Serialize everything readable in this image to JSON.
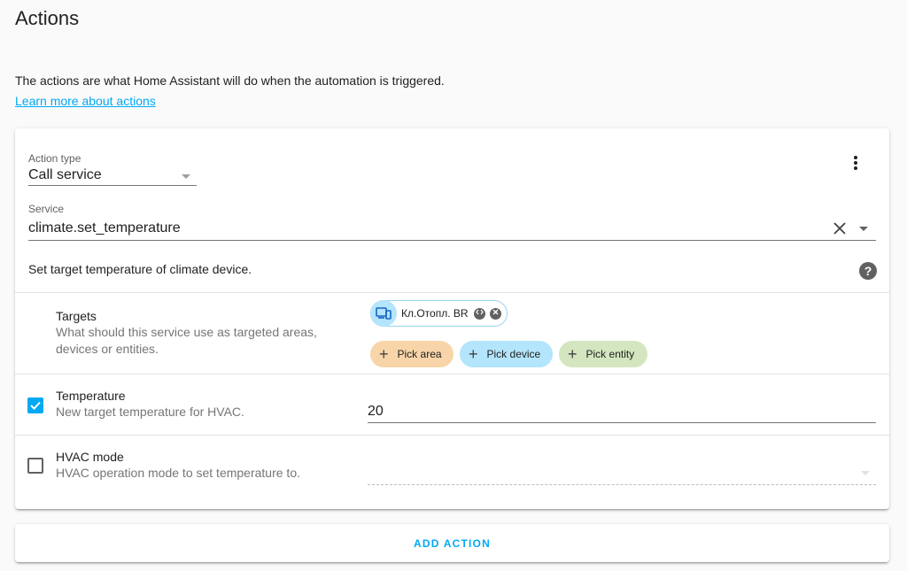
{
  "page": {
    "title": "Actions",
    "intro": "The actions are what Home Assistant will do when the automation is triggered.",
    "learn_more": "Learn more about actions"
  },
  "action": {
    "type_label": "Action type",
    "type_value": "Call service",
    "service_label": "Service",
    "service_value": "climate.set_temperature",
    "description": "Set target temperature of climate device.",
    "help_glyph": "?"
  },
  "targets": {
    "title": "Targets",
    "description": "What should this service use as targeted areas, devices or entities.",
    "selected_chip": "Кл.Отопл. BR",
    "pick_area": "Pick area",
    "pick_device": "Pick device",
    "pick_entity": "Pick entity",
    "pick_icon_glyph": "+"
  },
  "temperature": {
    "title": "Temperature",
    "description": "New target temperature for HVAC.",
    "value": "20",
    "checked": true
  },
  "hvac": {
    "title": "HVAC mode",
    "description": "HVAC operation mode to set temperature to.",
    "value": "",
    "checked": false
  },
  "footer": {
    "add_action": "ADD ACTION"
  },
  "colors": {
    "accent": "#03a9f4",
    "pick_area_bg": "#f8d5a8",
    "pick_device_bg": "#b3e5fc",
    "pick_entity_bg": "#d4e6bf"
  }
}
